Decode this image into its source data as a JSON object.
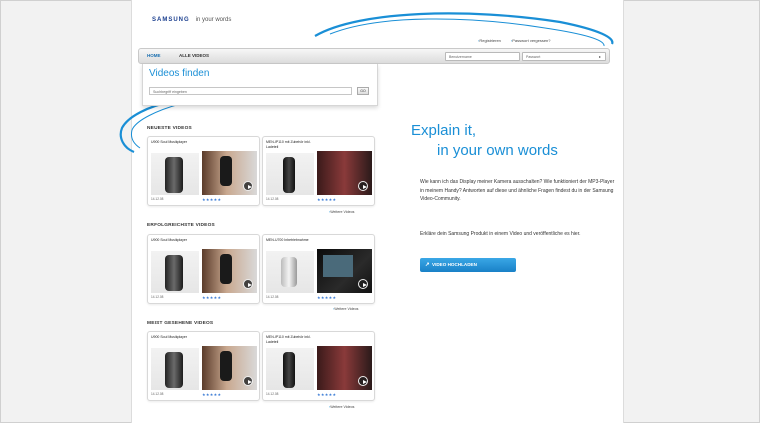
{
  "brand": {
    "logo": "SAMSUNG",
    "tagline": "in your words"
  },
  "top_links": [
    "Registrieren",
    "Passwort vergessen?"
  ],
  "nav": {
    "home": "HOME",
    "all_videos": "ALLE VIDEOS"
  },
  "login": {
    "username_placeholder": "Benutzername",
    "password_placeholder": "Passwort"
  },
  "finder": {
    "title": "Videos finden",
    "search_placeholder": "Suchbegriff eingeben",
    "search_button": "GO"
  },
  "sections": [
    {
      "title": "NEUESTE VIDEOS",
      "cards": [
        {
          "title": "U900 Soul Musikplayer",
          "duration": "14.12.08",
          "rating": "★★★★★"
        },
        {
          "title": "MEN-IP110 mit Zubehör inkl. Ladeteil",
          "duration": "14.12.08",
          "rating": "★★★★★"
        }
      ],
      "more": "Weitere Videos"
    },
    {
      "title": "ERFOLGREICHSTE VIDEOS",
      "cards": [
        {
          "title": "U900 Soul Musikplayer",
          "duration": "14.12.08",
          "rating": "★★★★★"
        },
        {
          "title": "MEN-U700 Inbetriebnahme",
          "duration": "14.12.08",
          "rating": "★★★★★"
        }
      ],
      "more": "Weitere Videos"
    },
    {
      "title": "MEIST GESEHENE VIDEOS",
      "cards": [
        {
          "title": "U900 Soul Musikplayer",
          "duration": "14.12.08",
          "rating": "★★★★★"
        },
        {
          "title": "MEN-IP110 mit Zubehör inkl. Ladeteil",
          "duration": "14.12.08",
          "rating": "★★★★★"
        }
      ],
      "more": "Weitere Videos"
    }
  ],
  "promo": {
    "headline_1": "Explain it,",
    "headline_2": "in your own words",
    "paragraph_1": "Wie kann ich das Display meiner Kamera ausschalten? Wie funktioniert der MP3-Player in meinem Handy? Antworten auf diese und ähnliche Fragen findest du in der Samsung Video-Community.",
    "paragraph_2": "Erkläre dein Samsung Produkt in einem Video und veröffentliche es hier.",
    "upload_button": "VIDEO HOCHLADEN"
  },
  "colors": {
    "accent": "#1a8fd6",
    "brand": "#1b3f8f"
  }
}
